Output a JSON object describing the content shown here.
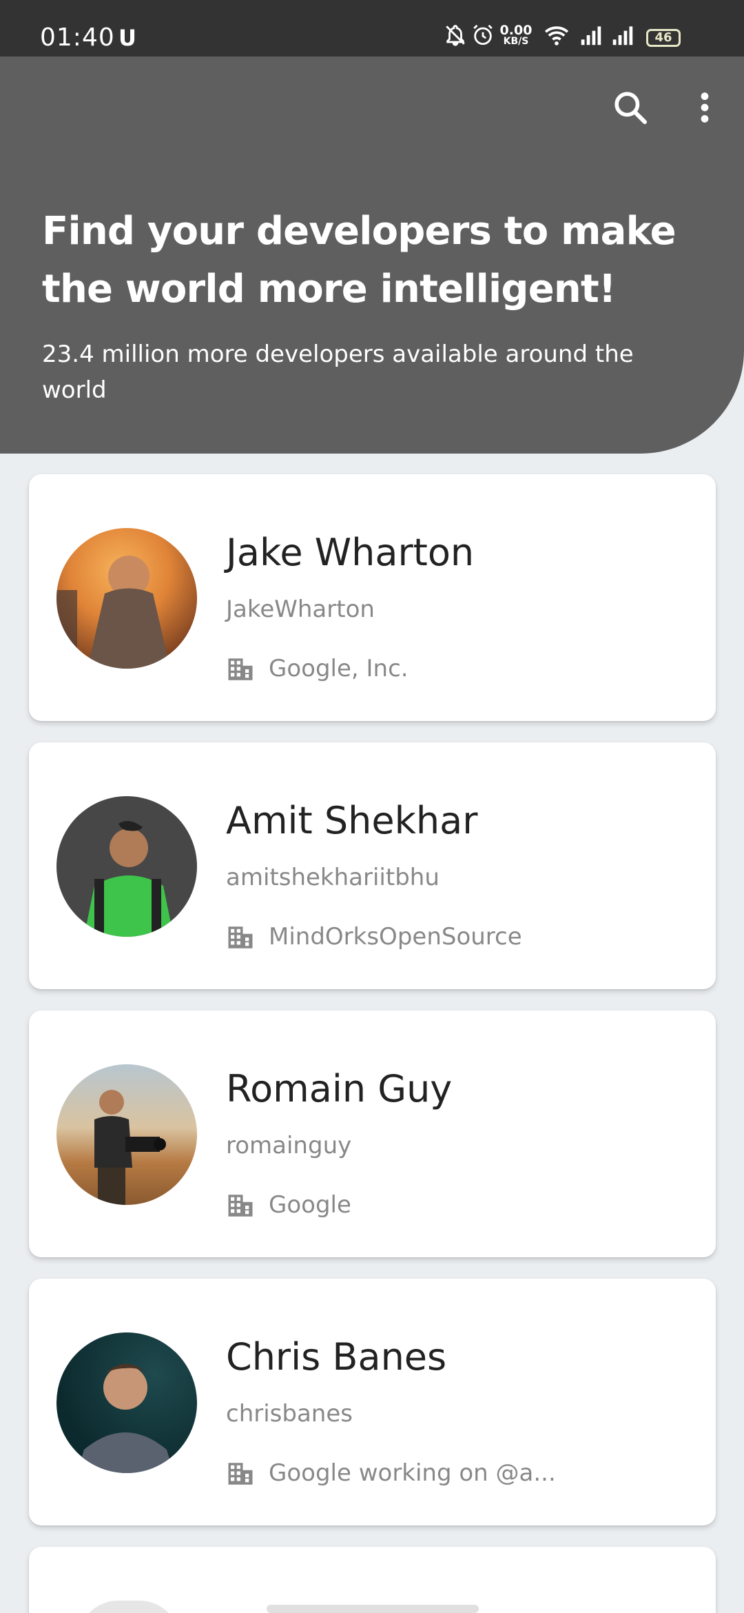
{
  "status_bar": {
    "time": "01:40",
    "app_glyph": "U",
    "net_speed_value": "0.00",
    "net_speed_unit": "KB/S",
    "battery": "46",
    "icons": [
      "bell-off-icon",
      "alarm-icon",
      "wifi-icon",
      "signal-icon",
      "signal-icon",
      "battery-icon"
    ]
  },
  "header": {
    "title": "Find your developers to make the world more intelligent!",
    "subtitle": "23.4 million more developers available around the world",
    "actions": [
      "search-icon",
      "more-vert-icon"
    ],
    "background": "#5f5f5f"
  },
  "developers": [
    {
      "name": "Jake Wharton",
      "login": "JakeWharton",
      "company": "Google, Inc."
    },
    {
      "name": "Amit Shekhar",
      "login": "amitshekhariitbhu",
      "company": "MindOrksOpenSource"
    },
    {
      "name": "Romain Guy",
      "login": "romainguy",
      "company": "Google"
    },
    {
      "name": "Chris Banes",
      "login": "chrisbanes",
      "company": "Google working on @a..."
    }
  ],
  "colors": {
    "page_background": "#ebeef1",
    "card": "#ffffff",
    "name_text": "#222222",
    "secondary_text": "#888888"
  }
}
